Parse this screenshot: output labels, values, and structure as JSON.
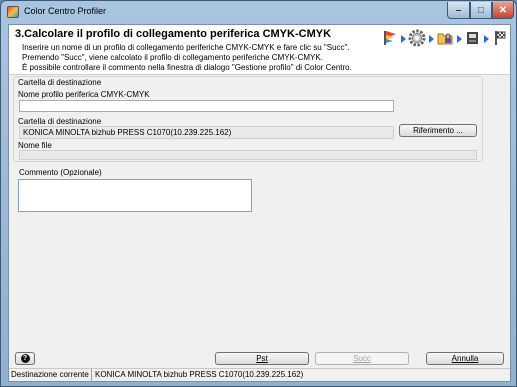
{
  "window": {
    "title": "Color Centro Profiler",
    "minimize_glyph": "–",
    "maximize_glyph": "□",
    "close_glyph": "✕"
  },
  "header": {
    "step_title": "3.Calcolare il profilo di collegamento periferica CMYK-CMYK",
    "description": [
      "Inserire un nome di un profilo di collegamento periferiche CMYK-CMYK e fare clic su \"Succ\".",
      "Premendo \"Succ\", viene calcolato il profilo di collegamento periferiche CMYK-CMYK.",
      "È possibile controllare il commento nella finestra di dialogo \"Gestione profilo\" di Color Centro."
    ],
    "step_icons": [
      "start-flag-icon",
      "gear-icon",
      "folder-lock-icon",
      "printer-icon",
      "finish-flag-icon"
    ],
    "accent_color": "#2a6bd1"
  },
  "destination": {
    "group_label": "Cartella di destinazione",
    "profile_name_label": "Nome profilo periferica CMYK-CMYK",
    "profile_name_value": "",
    "folder_label": "Cartella di destinazione",
    "folder_value": "KONICA MINOLTA bizhub PRESS C1070(10.239.225.162)",
    "browse_button": "Riferimento ...",
    "file_name_label": "Nome file",
    "file_name_value": ""
  },
  "comment": {
    "label": "Commento (Opzionale)",
    "value": ""
  },
  "footer": {
    "help_glyph": "?",
    "prev_button": "Pst",
    "next_button": "Succ",
    "cancel_button": "Annulla"
  },
  "status": {
    "label": "Destinazione corrente",
    "value": "KONICA MINOLTA bizhub PRESS C1070(10.239.225.162)"
  }
}
